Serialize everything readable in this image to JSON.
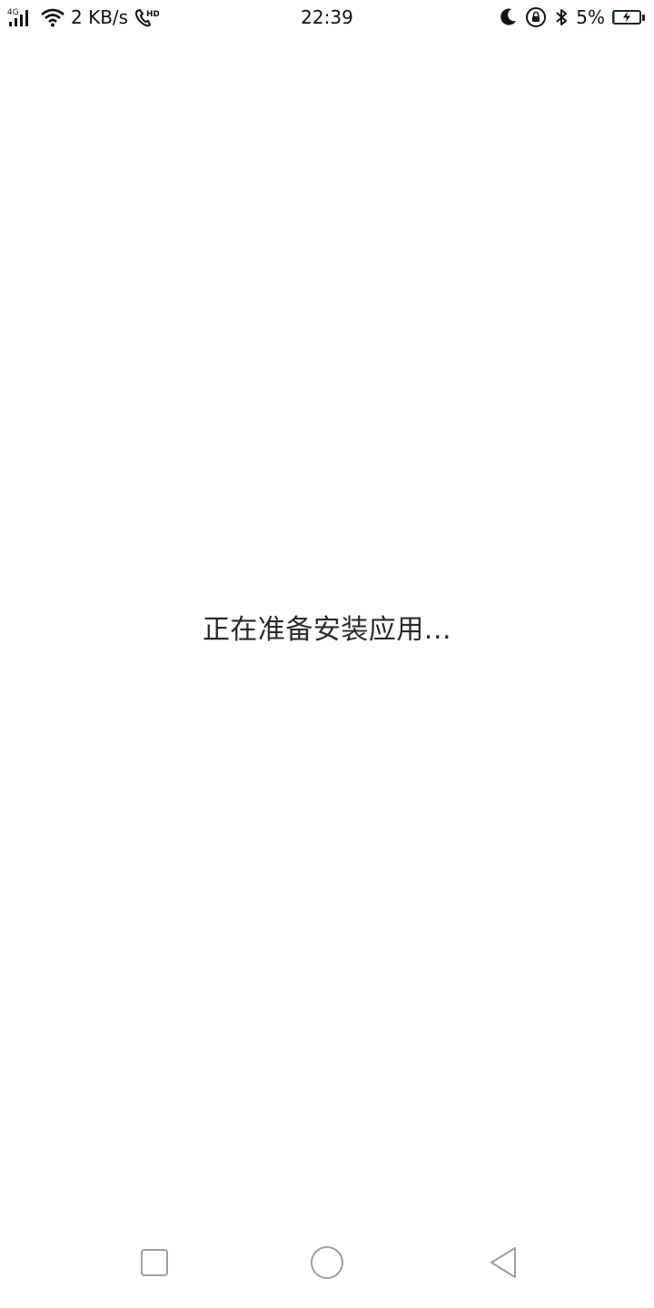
{
  "status_bar": {
    "network_type": "4G",
    "net_speed": "2 KB/s",
    "hd_label": "HD",
    "time": "22:39",
    "battery_percent": "5%",
    "battery_level": 0.05,
    "icons": [
      "signal-icon",
      "wifi-icon",
      "hd-call-icon",
      "moon-icon",
      "rotation-lock-icon",
      "bluetooth-icon",
      "battery-charging-icon"
    ]
  },
  "main": {
    "message": "正在准备安装应用..."
  },
  "nav_bar": {
    "buttons": [
      "recents",
      "home",
      "back"
    ]
  },
  "colors": {
    "background": "#ffffff",
    "text": "#2a2a2a",
    "battery_fill": "#2ec27e",
    "nav_icon": "#9e9e9e"
  }
}
